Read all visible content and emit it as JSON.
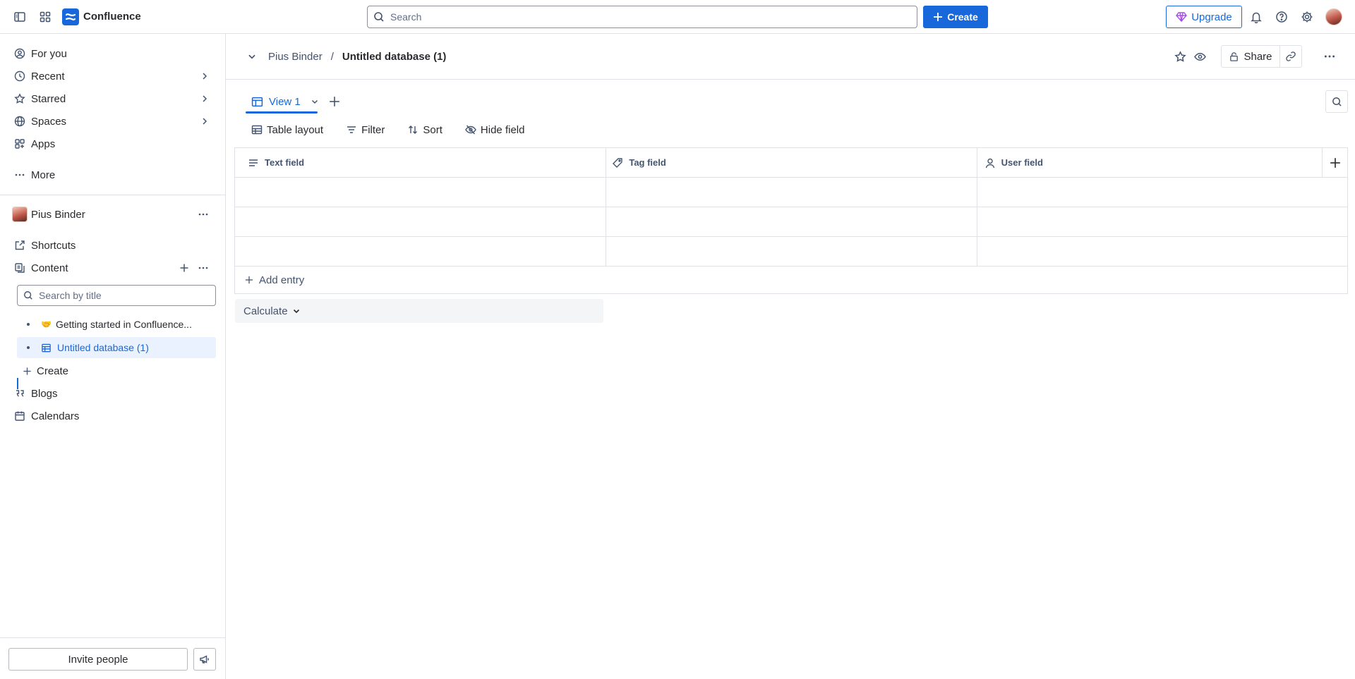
{
  "topbar": {
    "brand": "Confluence",
    "search_placeholder": "Search",
    "create_label": "Create",
    "upgrade_label": "Upgrade",
    "icons": [
      "sidebar-toggle-icon",
      "app-switcher-icon",
      "bell-icon",
      "help-icon",
      "gear-icon"
    ]
  },
  "sidebar": {
    "nav": [
      {
        "label": "For you",
        "icon": "user-circle-icon"
      },
      {
        "label": "Recent",
        "icon": "clock-icon"
      },
      {
        "label": "Starred",
        "icon": "star-icon"
      },
      {
        "label": "Spaces",
        "icon": "globe-icon"
      },
      {
        "label": "Apps",
        "icon": "apps-icon"
      },
      {
        "label": "More",
        "icon": "more-icon"
      }
    ],
    "space": {
      "name": "Pius Binder",
      "shortcuts_label": "Shortcuts",
      "content_label": "Content",
      "search_placeholder": "Search by title",
      "tree": [
        {
          "label": "Getting started in Confluence..."
        },
        {
          "label": "Untitled database (1)",
          "active": true
        }
      ],
      "create_label": "Create",
      "blogs_label": "Blogs",
      "calendars_label": "Calendars"
    },
    "invite_label": "Invite people"
  },
  "main": {
    "breadcrumb": {
      "parent": "Pius Binder",
      "separator": "/",
      "current": "Untitled database (1)"
    },
    "share_label": "Share",
    "view_tab": "View 1",
    "toolbar": {
      "layout": "Table layout",
      "filter": "Filter",
      "sort": "Sort",
      "hide": "Hide field"
    },
    "table": {
      "columns": [
        {
          "label": "Text field",
          "icon": "text-lines-icon"
        },
        {
          "label": "Tag field",
          "icon": "tag-icon"
        },
        {
          "label": "User field",
          "icon": "person-icon"
        }
      ],
      "rows": [
        [
          "",
          "",
          ""
        ],
        [
          "",
          "",
          ""
        ],
        [
          "",
          "",
          ""
        ]
      ],
      "add_entry": "Add entry"
    },
    "calculate_label": "Calculate"
  },
  "colors": {
    "accent": "#1868db",
    "active_bg": "#e9f2fe",
    "border": "#dfe1e6"
  }
}
